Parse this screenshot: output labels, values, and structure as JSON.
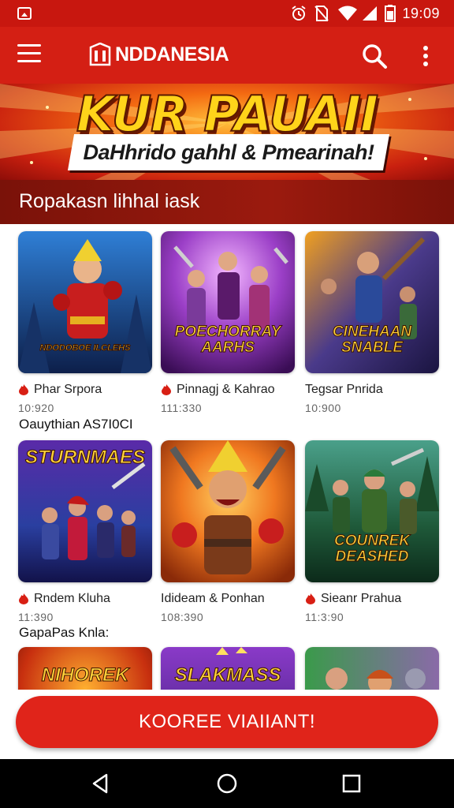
{
  "status_bar": {
    "time": "19:09",
    "icons": [
      "notification-icon",
      "alarm-icon",
      "no-sim-icon",
      "wifi-icon",
      "signal-icon",
      "battery-icon"
    ]
  },
  "app_bar": {
    "brand": "NDDANESIA",
    "icons": [
      "menu-icon",
      "brand-logo-icon",
      "search-icon",
      "more-vert-icon"
    ]
  },
  "banner": {
    "title": "KUR PAUAII",
    "subtitle": "DaHhrido gahhl & Pmearinah!"
  },
  "section": {
    "title": "Ropakasn lihhal iask"
  },
  "rows": [
    {
      "label": "",
      "items": [
        {
          "art_text": "NDODOBOE ILCLEHS",
          "title": "Phar Srpora",
          "meta": "10:920",
          "icon": "flame-icon"
        },
        {
          "art_text": "POECHORRAY AARHS",
          "title": "Pinnagj & Kahrao",
          "meta": "111:330",
          "icon": "flame-icon"
        },
        {
          "art_text": "CINEHAAN SNABLE",
          "title": "Tegsar Pnrida",
          "meta": "10:900",
          "icon": ""
        }
      ]
    },
    {
      "label": "Oauythian AS7I0CI",
      "items": [
        {
          "art_text": "STURNMAES",
          "title": "Rndem Kluha",
          "meta": "11:390",
          "icon": "flame-icon"
        },
        {
          "art_text": "",
          "title": "Idideam & Ponhan",
          "meta": "108:390",
          "icon": ""
        },
        {
          "art_text": "COUNREK DEASHED",
          "title": "Sieanr Prahua",
          "meta": "11:3:90",
          "icon": "flame-icon"
        }
      ]
    },
    {
      "label": "GapaPas Knla:",
      "items": [
        {
          "art_text": "NIHOREK",
          "title": "",
          "meta": "",
          "icon": ""
        },
        {
          "art_text": "SLAKMASS",
          "title": "",
          "meta": "",
          "icon": ""
        },
        {
          "art_text": "",
          "title": "",
          "meta": "",
          "icon": ""
        }
      ]
    }
  ],
  "cta": {
    "label": "KOOREE VIAIIANT!"
  },
  "nav_bar": {
    "icons": [
      "back-icon",
      "home-icon",
      "recents-icon"
    ]
  },
  "colors": {
    "brand_red": "#d41f14",
    "status_red": "#c8170f",
    "section_dark_red": "#7a1209",
    "cta_red": "#e0241a"
  }
}
